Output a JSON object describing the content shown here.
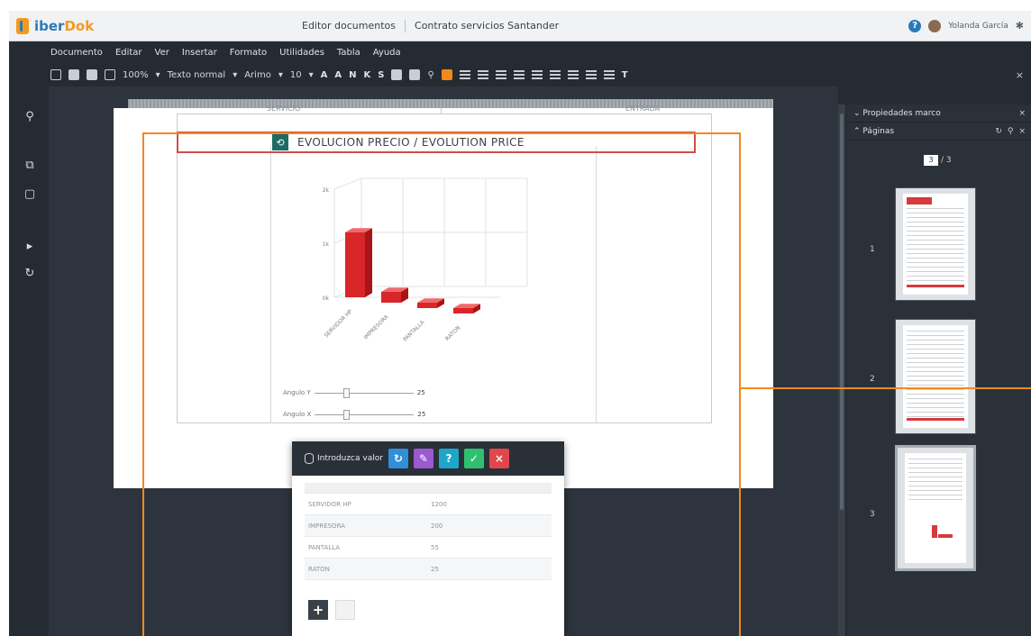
{
  "titlebar": {
    "logo_text_1": "iber",
    "logo_text_2": "Dok",
    "app_section": "Editor documentos",
    "document_name": "Contrato servicios Santander",
    "user_name": "Yolanda García"
  },
  "menu": [
    "Documento",
    "Editar",
    "Ver",
    "Insertar",
    "Formato",
    "Utilidades",
    "Tabla",
    "Ayuda"
  ],
  "toolbar": {
    "zoom": "100%",
    "style": "Texto normal",
    "font": "Arimo",
    "size": "10",
    "bold": "N",
    "italic": "K",
    "underline": "S",
    "text_size_icon": "T"
  },
  "document": {
    "top_left_cell": "SERVICIO",
    "top_right_cell": "ENTRADA",
    "chart_title": "EVOLUCION PRECIO / EVOLUTION PRICE",
    "angle_y_label": "Angulo Y",
    "angle_y_value": "25",
    "angle_x_label": "Angulo X",
    "angle_x_value": "25"
  },
  "chart_data": {
    "type": "bar",
    "categories": [
      "SERVIDOR HP",
      "IMPRESORA",
      "PANTALLA",
      "RATON"
    ],
    "values": [
      1200,
      200,
      55,
      25
    ],
    "y_tick_labels": [
      "2k",
      "1k",
      "0k"
    ],
    "ylim": [
      0,
      2000
    ],
    "bar_color": "#d9262a"
  },
  "popup": {
    "title": "Introduzca valor",
    "rows": [
      {
        "label": "SERVIDOR HP",
        "value": "1200"
      },
      {
        "label": "IMPRESORA",
        "value": "200"
      },
      {
        "label": "PANTALLA",
        "value": "55"
      },
      {
        "label": "RATON",
        "value": "25"
      }
    ]
  },
  "panel": {
    "properties_label": "Propiedades marco",
    "pages_label": "Páginas",
    "current_page": "3",
    "total_pages": "/ 3",
    "thumbnails": [
      "1",
      "2",
      "3"
    ]
  },
  "colors": {
    "highlight": "#f08a1c",
    "brand_blue": "#2a7ab8",
    "dark_bg": "#252b33"
  }
}
